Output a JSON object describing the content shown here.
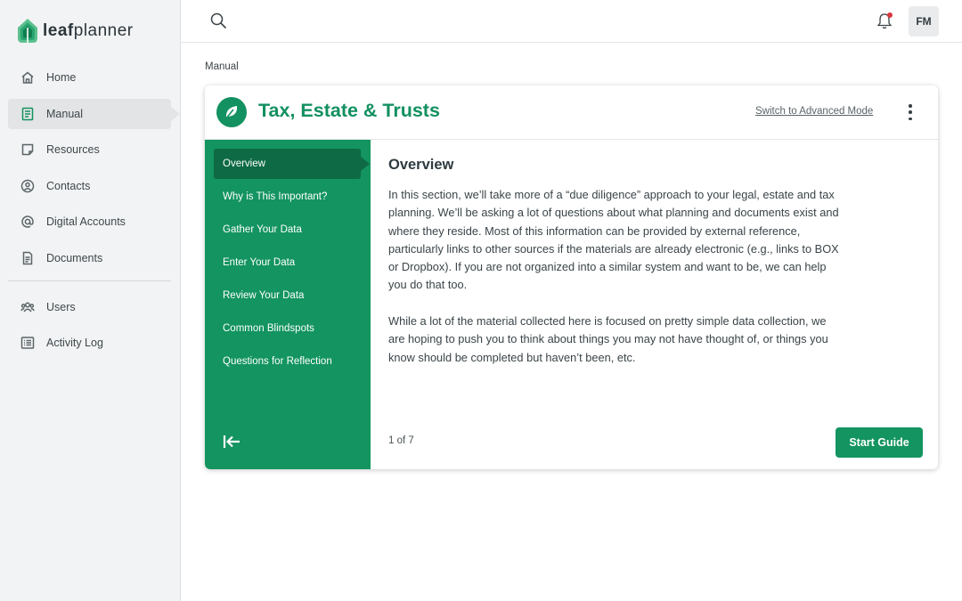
{
  "app": {
    "logo_bold": "leaf",
    "logo_light": "planner",
    "brand_color": "#139460"
  },
  "sidebar": {
    "items": [
      {
        "label": "Home",
        "icon": "home-icon"
      },
      {
        "label": "Manual",
        "icon": "book-icon",
        "active": true
      },
      {
        "label": "Resources",
        "icon": "note-icon"
      },
      {
        "label": "Contacts",
        "icon": "contact-icon"
      },
      {
        "label": "Digital Accounts",
        "icon": "at-icon"
      },
      {
        "label": "Documents",
        "icon": "document-icon"
      },
      {
        "label": "Users",
        "icon": "users-icon"
      },
      {
        "label": "Activity Log",
        "icon": "list-icon"
      }
    ]
  },
  "topbar": {
    "avatar_initials": "FM",
    "notification_dot_color": "#d9363e"
  },
  "breadcrumb": "Manual",
  "card": {
    "title": "Tax, Estate & Trusts",
    "switch_mode_label": "Switch to Advanced Mode",
    "steps": [
      "Overview",
      "Why is This Important?",
      "Gather Your Data",
      "Enter Your Data",
      "Review Your Data",
      "Common Blindspots",
      "Questions for Reflection"
    ],
    "active_step": "Overview",
    "content": {
      "heading": "Overview",
      "paragraph_1": "In this section, we’ll take more of a “due diligence” approach to your legal, estate and tax planning. We’ll be asking a lot of questions about what planning and documents exist and where they reside. Most of this information can be provided by external reference, particularly links to other sources if the materials are already electronic (e.g., links to BOX or Dropbox). If you are not organized into a similar system and want to be, we can help you do that too.",
      "paragraph_2": "While a lot of the material collected here is focused on pretty simple data collection, we are hoping to push you to think about things you may not have thought of, or things you know should be completed but haven’t been, etc."
    },
    "pager": "1 of 7",
    "start_button": "Start Guide"
  }
}
